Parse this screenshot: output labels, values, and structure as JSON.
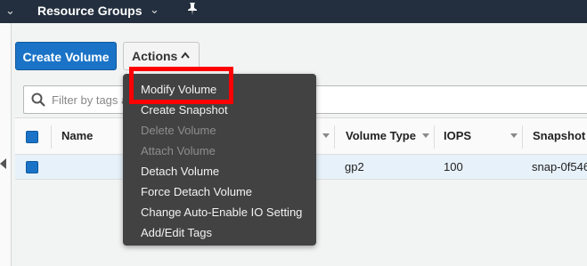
{
  "topnav": {
    "resource_groups": "Resource Groups"
  },
  "toolbar": {
    "create_volume": "Create Volume",
    "actions": "Actions"
  },
  "filter": {
    "placeholder": "Filter by tags a"
  },
  "table": {
    "headers": [
      "Name",
      "Volume Type",
      "IOPS",
      "Snapshot"
    ],
    "rows": [
      {
        "volume_type": "gp2",
        "iops": "100",
        "snapshot": "snap-0f546"
      }
    ]
  },
  "actions_menu": {
    "items": [
      {
        "label": "Modify Volume",
        "enabled": true
      },
      {
        "label": "Create Snapshot",
        "enabled": true
      },
      {
        "label": "Delete Volume",
        "enabled": false
      },
      {
        "label": "Attach Volume",
        "enabled": false
      },
      {
        "label": "Detach Volume",
        "enabled": true
      },
      {
        "label": "Force Detach Volume",
        "enabled": true
      },
      {
        "label": "Change Auto-Enable IO Setting",
        "enabled": true
      },
      {
        "label": "Add/Edit Tags",
        "enabled": true
      }
    ]
  },
  "colors": {
    "nav_bg": "#232f3e",
    "primary_button": "#1a73c7",
    "menu_bg": "#424242",
    "highlight": "#ff0000",
    "selected_row": "#e7f1fa"
  }
}
